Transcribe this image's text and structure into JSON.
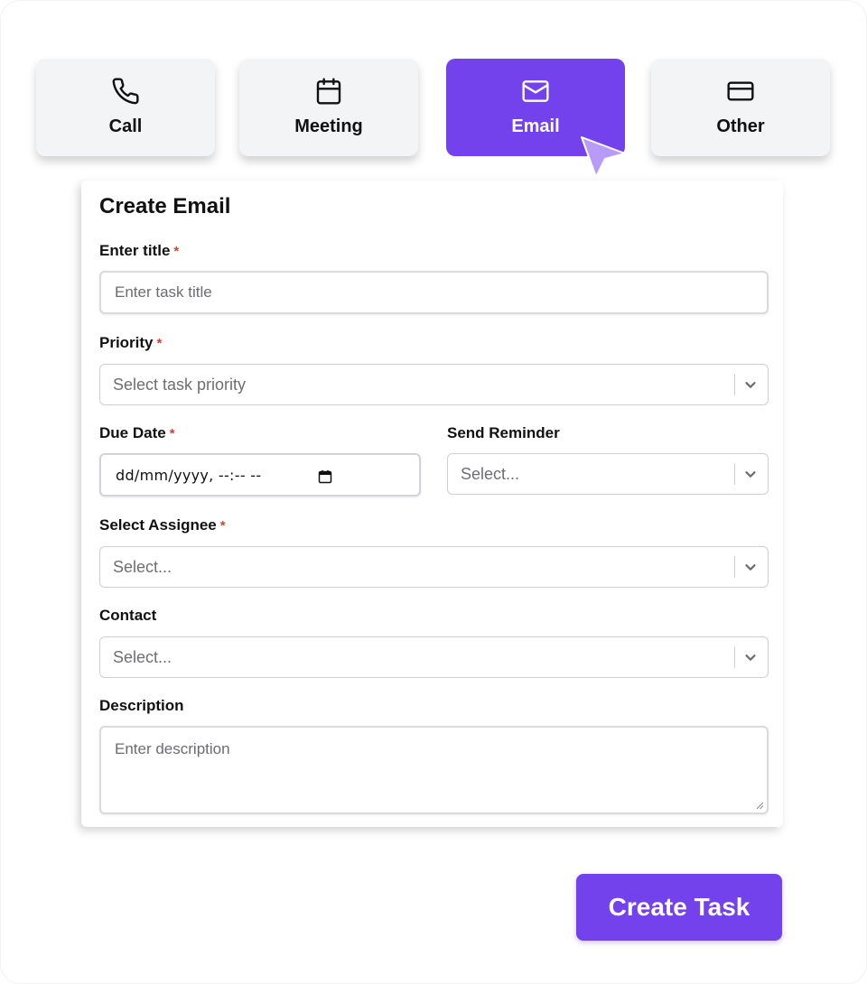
{
  "tabs": [
    {
      "label": "Call",
      "icon": "phone-icon",
      "active": false
    },
    {
      "label": "Meeting",
      "icon": "calendar-icon",
      "active": false
    },
    {
      "label": "Email",
      "icon": "mail-icon",
      "active": true
    },
    {
      "label": "Other",
      "icon": "card-icon",
      "active": false
    }
  ],
  "form": {
    "title": "Create Email",
    "required_mark": "*",
    "title_field": {
      "label": "Enter title",
      "placeholder": "Enter task title"
    },
    "priority": {
      "label": "Priority",
      "placeholder": "Select task priority"
    },
    "due_date": {
      "label": "Due Date",
      "value": "dd/mm/yyyy, --:-- --"
    },
    "send_reminder": {
      "label": "Send Reminder",
      "placeholder": "Select..."
    },
    "assignee": {
      "label": "Select Assignee",
      "placeholder": "Select..."
    },
    "contact": {
      "label": "Contact",
      "placeholder": "Select..."
    },
    "description": {
      "label": "Description",
      "placeholder": "Enter description"
    }
  },
  "actions": {
    "create_label": "Create Task"
  },
  "colors": {
    "accent": "#7442ec",
    "tab_bg": "#f3f4f6",
    "required": "#e03c3c",
    "cursor": "#b79bf7"
  }
}
